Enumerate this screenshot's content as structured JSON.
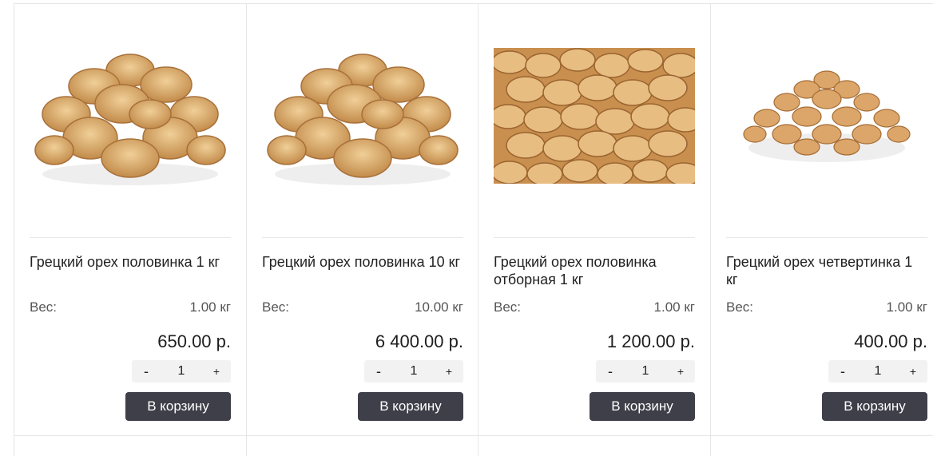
{
  "products": [
    {
      "title": "Грецкий орех половинка 1 кг",
      "weight_label": "Вес:",
      "weight_value": "1.00 кг",
      "price": "650.00 р.",
      "qty_minus": "-",
      "qty_value": "1",
      "qty_plus": "+",
      "cart_label": "В корзину",
      "image_icon": "walnut-halves-pile-icon"
    },
    {
      "title": "Грецкий орех половинка 10 кг",
      "weight_label": "Вес:",
      "weight_value": "10.00 кг",
      "price": "6 400.00 р.",
      "qty_minus": "-",
      "qty_value": "1",
      "qty_plus": "+",
      "cart_label": "В корзину",
      "image_icon": "walnut-halves-pile-icon"
    },
    {
      "title": "Грецкий орех половинка отборная 1 кг",
      "weight_label": "Вес:",
      "weight_value": "1.00 кг",
      "price": "1 200.00 р.",
      "qty_minus": "-",
      "qty_value": "1",
      "qty_plus": "+",
      "cart_label": "В корзину",
      "image_icon": "walnut-kernels-closeup-icon"
    },
    {
      "title": "Грецкий орех четвертинка 1 кг",
      "weight_label": "Вес:",
      "weight_value": "1.00 кг",
      "price": "400.00 р.",
      "qty_minus": "-",
      "qty_value": "1",
      "qty_plus": "+",
      "cart_label": "В корзину",
      "image_icon": "walnut-quarters-pile-icon"
    }
  ],
  "colors": {
    "button_bg": "#3f3f4a",
    "qty_bg": "#f2f2f2",
    "walnut_light": "#e2b87a",
    "walnut_dark": "#b07a3c"
  }
}
